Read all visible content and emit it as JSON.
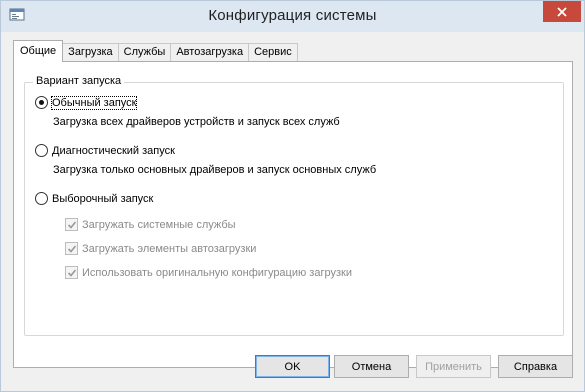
{
  "window": {
    "title": "Конфигурация системы"
  },
  "tabs": [
    {
      "label": "Общие",
      "active": true
    },
    {
      "label": "Загрузка"
    },
    {
      "label": "Службы"
    },
    {
      "label": "Автозагрузка"
    },
    {
      "label": "Сервис"
    }
  ],
  "startup": {
    "group_label": "Вариант запуска",
    "normal": {
      "label": "Обычный запуск",
      "description": "Загрузка всех драйверов устройств и запуск всех служб",
      "checked": true
    },
    "diagnostic": {
      "label": "Диагностический запуск",
      "description": "Загрузка только основных драйверов и запуск основных служб",
      "checked": false
    },
    "selective": {
      "label": "Выборочный запуск",
      "checked": false,
      "options": [
        {
          "label": "Загружать системные службы",
          "checked": true,
          "enabled": false
        },
        {
          "label": "Загружать элементы автозагрузки",
          "checked": true,
          "enabled": false
        },
        {
          "label": "Использовать оригинальную конфигурацию загрузки",
          "checked": true,
          "enabled": false
        }
      ]
    }
  },
  "buttons": {
    "ok": "OK",
    "cancel": "Отмена",
    "apply": "Применить",
    "help": "Справка"
  },
  "colors": {
    "titlebar": "#dde7f2",
    "close_button": "#c7493c",
    "default_button_border": "#3c7fb1"
  },
  "icons": {
    "app": "msconfig-app-icon",
    "close": "close-icon",
    "checkbox": "checkmark-icon"
  }
}
